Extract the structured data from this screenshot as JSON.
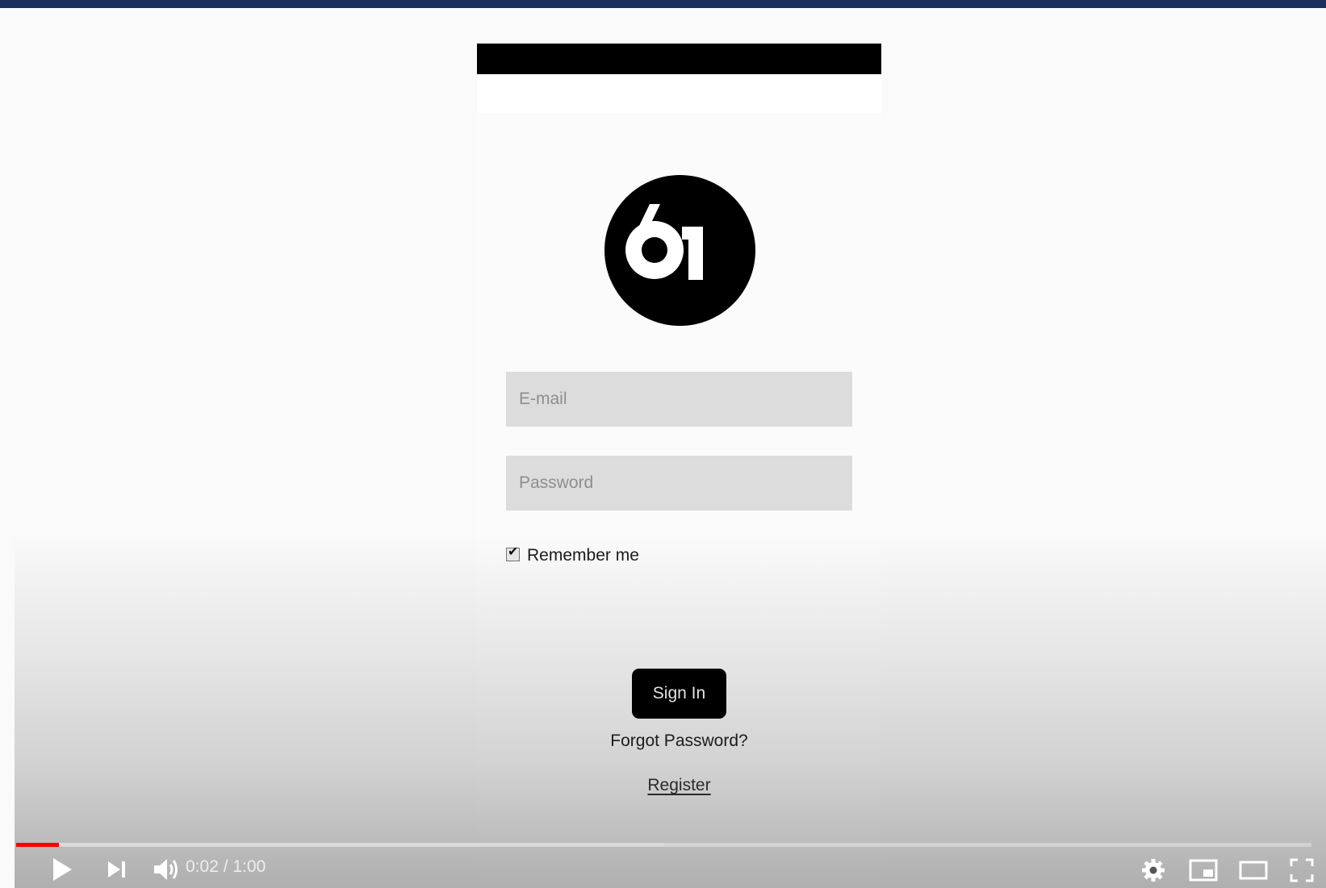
{
  "colors": {
    "top_bar": "#1a2f5a",
    "progress_played": "#ff0000",
    "button_bg": "#000000",
    "input_bg": "#dcdcdd"
  },
  "login": {
    "logo_icon": "logo-61-icon",
    "email_placeholder": "E-mail",
    "password_placeholder": "Password",
    "remember_label": "Remember me",
    "remember_checked": true,
    "signin_label": "Sign In",
    "forgot_label": "Forgot Password?",
    "register_label": "Register"
  },
  "player": {
    "current_time": "0:02",
    "duration": "1:00",
    "time_display": "0:02 / 1:00",
    "progress_played_fraction": 0.033,
    "progress_buffered_fraction": 0.5,
    "icons": [
      "play-icon",
      "next-icon",
      "volume-icon",
      "settings-icon",
      "miniplayer-icon",
      "theater-icon",
      "fullscreen-icon"
    ]
  }
}
